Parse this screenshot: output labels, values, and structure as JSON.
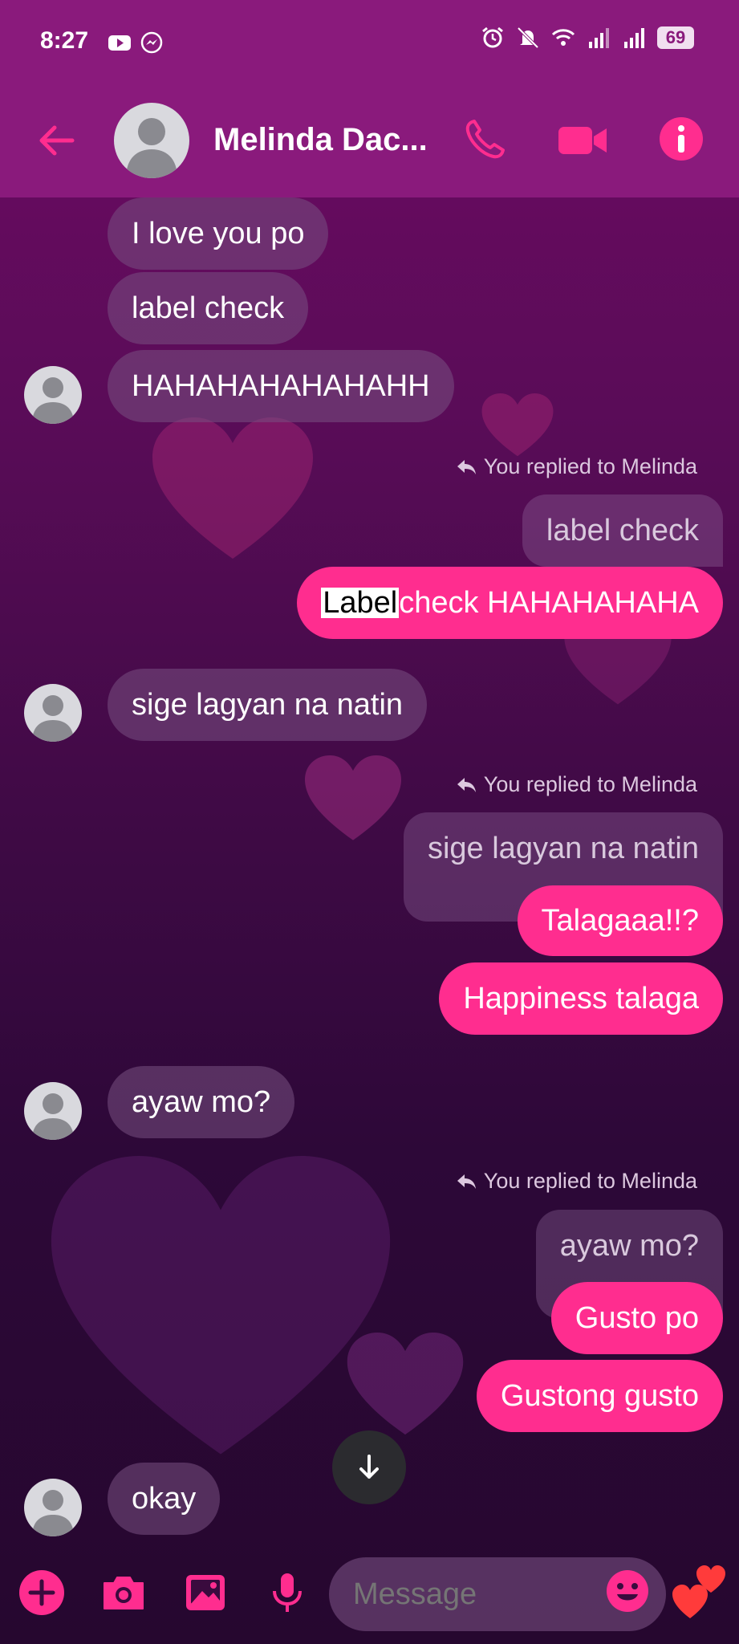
{
  "status_bar": {
    "time": "8:27",
    "battery": "69"
  },
  "header": {
    "contact_name": "Melinda Dac..."
  },
  "messages": [
    {
      "side": "in",
      "text": "I love you po"
    },
    {
      "side": "in",
      "text": "label check"
    },
    {
      "side": "in",
      "text": "HAHAHAHAHAHAHH"
    },
    {
      "reply_note": "You replied to Melinda",
      "quoted": "label check",
      "highlight": "Label",
      "rest": " check HAHAHAHAHA"
    },
    {
      "side": "in",
      "text": "sige lagyan na natin"
    },
    {
      "reply_note": "You replied to Melinda",
      "quoted": "sige lagyan na natin",
      "out1": "Talagaaa!!?",
      "out2": "Happiness talaga"
    },
    {
      "side": "in",
      "text": "ayaw mo?"
    },
    {
      "reply_note": "You replied to Melinda",
      "quoted": "ayaw mo?",
      "out1": "Gusto po",
      "out2": "Gustong gusto"
    },
    {
      "side": "in",
      "text": "okay"
    }
  ],
  "composer": {
    "placeholder": "Message"
  },
  "colors": {
    "header_bg": "#8a1a7c",
    "accent": "#ff2d8f",
    "incoming_bubble": "#6f4f78"
  }
}
